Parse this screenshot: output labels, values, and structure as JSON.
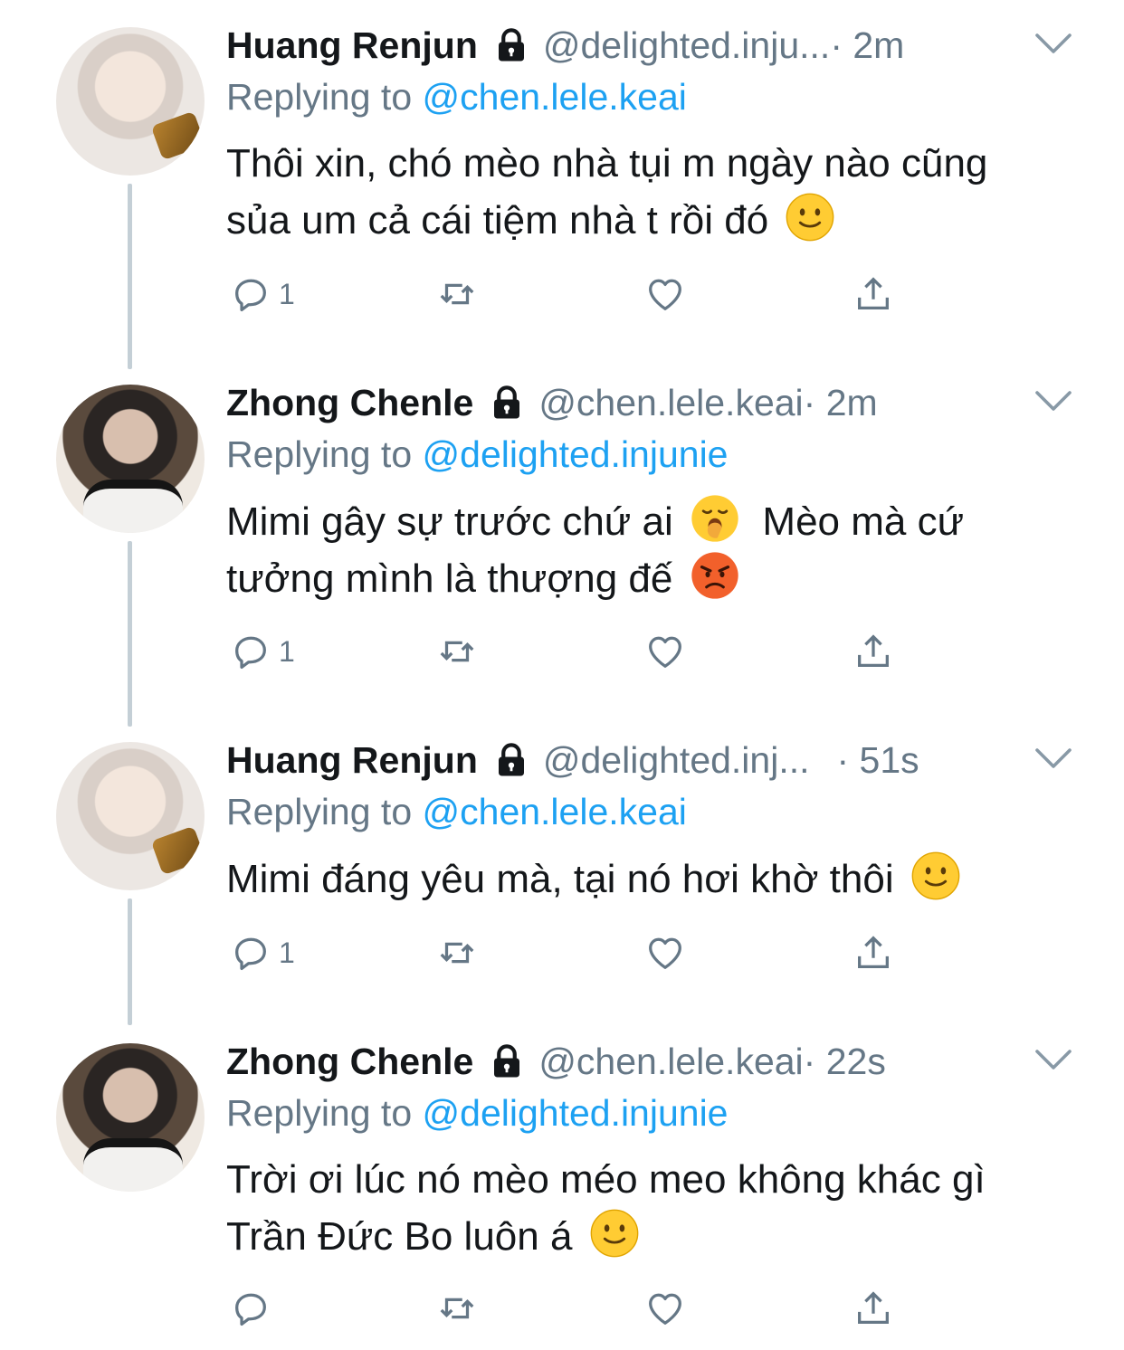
{
  "tweets": [
    {
      "name": "Huang Renjun",
      "handle": "@delighted.inju...",
      "time": "· 2m",
      "replying_prefix": "Replying to ",
      "replying_to": "@chen.lele.keai",
      "line1": "Thôi xin, chó mèo nhà tụi m ngày nào cũng",
      "line2": "sủa um cả cái tiệm nhà t rồi đó",
      "emoji": "slightly-smiling-face",
      "replies": "1"
    },
    {
      "name": "Zhong Chenle",
      "handle": "@chen.lele.keai",
      "time": "· 2m",
      "replying_prefix": "Replying to ",
      "replying_to": "@delighted.injunie",
      "line1a": "Mimi gây sự trước chứ ai",
      "line1b": "Mèo mà cứ",
      "line2": "tưởng mình là thượng đế",
      "emoji1": "yawning-face",
      "emoji2": "angry-face",
      "replies": "1"
    },
    {
      "name": "Huang Renjun",
      "handle": "@delighted.inj...",
      "time": "· 51s",
      "replying_prefix": "Replying to ",
      "replying_to": "@chen.lele.keai",
      "line1": "Mimi đáng yêu mà, tại nó hơi khờ thôi",
      "emoji": "slightly-smiling-face",
      "replies": "1"
    },
    {
      "name": "Zhong Chenle",
      "handle": "@chen.lele.keai",
      "time": "· 22s",
      "replying_prefix": "Replying to ",
      "replying_to": "@delighted.injunie",
      "line1": "Trời ơi lúc nó mèo méo meo không khác gì",
      "line2": "Trần Đức Bo luôn á",
      "emoji": "slightly-smiling-face",
      "replies": ""
    }
  ],
  "colors": {
    "link": "#1da1f2",
    "secondary": "#657786",
    "thread": "#c4cfd6"
  }
}
